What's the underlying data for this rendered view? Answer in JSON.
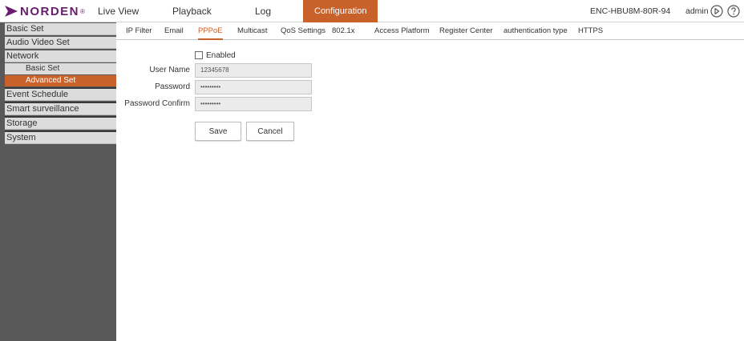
{
  "header": {
    "brand": "NORDEN",
    "brand_mark": "®",
    "nav": [
      "Live View",
      "Playback",
      "Log",
      "Configuration"
    ],
    "active_nav": "Configuration",
    "device_name": "ENC-HBU8M-80R-94",
    "user": "admin",
    "icons": [
      "logout-icon",
      "help-icon"
    ]
  },
  "sidebar": {
    "items": [
      {
        "label": "Basic Set"
      },
      {
        "label": "Audio Video Set"
      },
      {
        "label": "Network",
        "children": [
          "Basic Set",
          "Advanced Set"
        ],
        "active_child": "Advanced Set"
      },
      {
        "label": "Event Schedule"
      },
      {
        "label": "Smart surveillance"
      },
      {
        "label": "Storage"
      },
      {
        "label": "System"
      }
    ]
  },
  "tabs": {
    "items": [
      "IP Filter",
      "Email",
      "PPPoE",
      "Multicast",
      "QoS Settings",
      "802.1x",
      "Access Platform",
      "Register Center",
      "authentication type",
      "HTTPS"
    ],
    "active": "PPPoE"
  },
  "form": {
    "enabled_label": "Enabled",
    "enabled_checked": false,
    "username_label": "User Name",
    "username_value": "12345678",
    "password_label": "Password",
    "password_value": "•••••••••",
    "password_confirm_label": "Password Confirm",
    "password_confirm_value": "•••••••••",
    "save_label": "Save",
    "cancel_label": "Cancel"
  },
  "colors": {
    "accent": "#c8612a",
    "brand": "#6a1b6e",
    "sidebar_bg": "#595959",
    "menu_bg": "#dcdcdc"
  }
}
